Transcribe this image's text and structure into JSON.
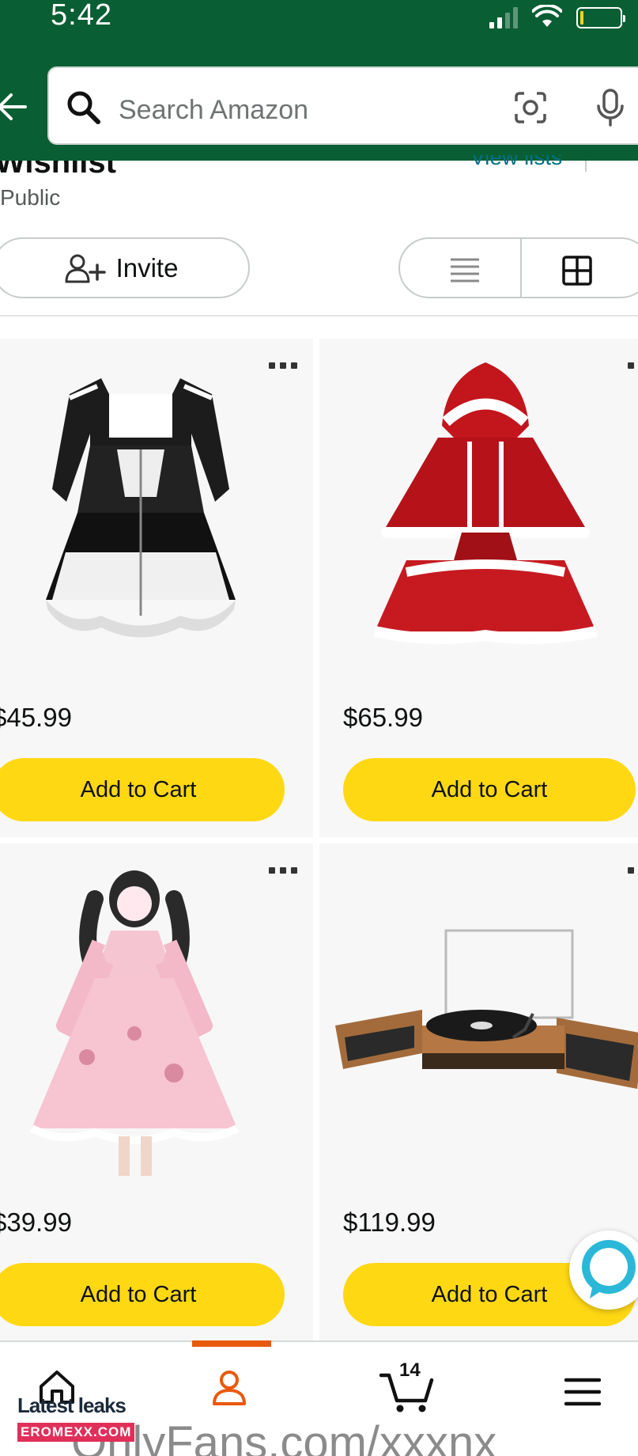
{
  "status_bar": {
    "time": "5:42"
  },
  "search": {
    "placeholder": "Search Amazon"
  },
  "wishlist": {
    "title": "Wishlist",
    "view_lists_label": "View lists",
    "privacy": "Public",
    "invite_label": "Invite"
  },
  "products": [
    {
      "price": "$45.99",
      "add_to_cart": "Add to Cart",
      "image": "black-white-maid-dress"
    },
    {
      "price": "$65.99",
      "add_to_cart": "Add to Cart",
      "image": "red-hooded-christmas-dress"
    },
    {
      "price": "$39.99",
      "add_to_cart": "Add to Cart",
      "image": "pink-lolita-dress"
    },
    {
      "price": "$119.99",
      "add_to_cart": "Add to Cart",
      "image": "record-player-with-speakers"
    }
  ],
  "bottom_nav": {
    "items": [
      "home-icon",
      "profile-icon",
      "cart-icon",
      "menu-icon"
    ],
    "cart_count": "14",
    "active": "profile"
  },
  "watermark": {
    "top": "Latest leaks",
    "badge": "EROMEXX.COM",
    "bottom": "OnlyFans.com/xxxnx"
  },
  "colors": {
    "header": "#0a5e33",
    "add_to_cart": "#ffd814",
    "link": "#007185",
    "active_tab": "#e8590c"
  }
}
